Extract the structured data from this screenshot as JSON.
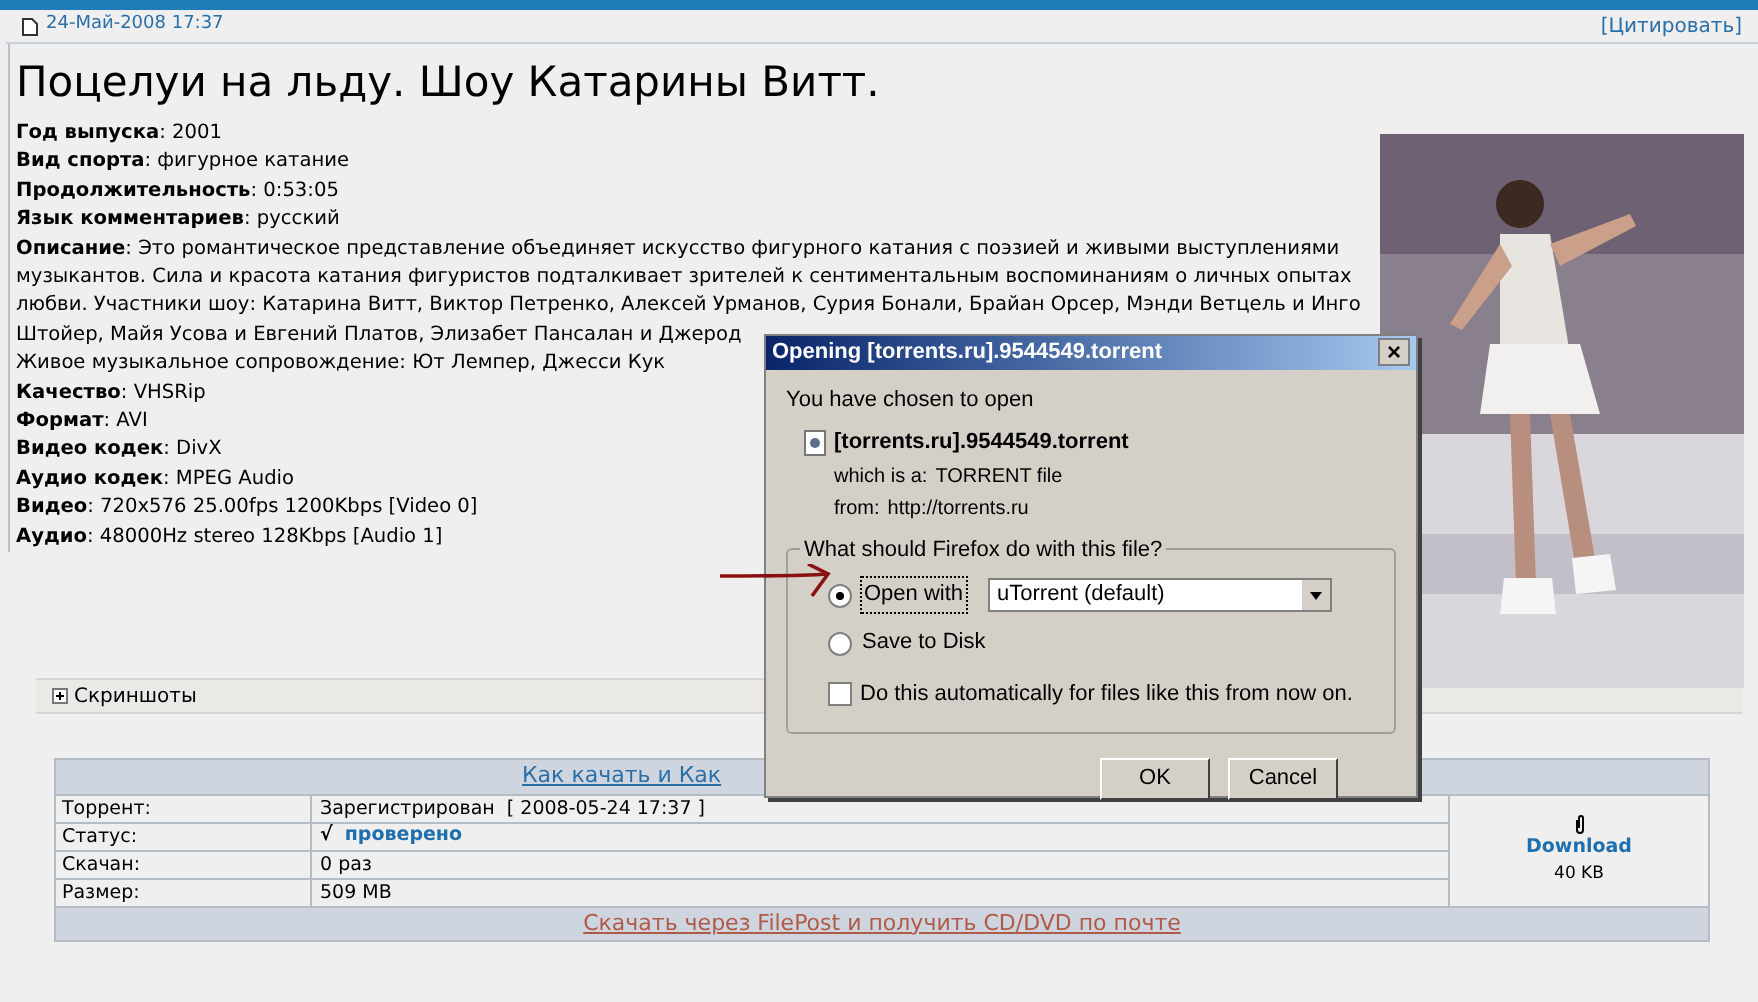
{
  "post": {
    "date": "24-Май-2008 17:37",
    "quote_link": "[Цитировать]"
  },
  "title": "Поцелуи на льду. Шоу Катарины Витт.",
  "fields": [
    {
      "kind": "labeled",
      "label": "Год выпуска",
      "value": ": 2001"
    },
    {
      "kind": "labeled",
      "label": "Вид спорта",
      "value": ": фигурное катание"
    },
    {
      "kind": "labeled",
      "label": "Продолжительность",
      "value": ": 0:53:05"
    },
    {
      "kind": "labeled",
      "label": "Язык комментариев",
      "value": ": русский"
    },
    {
      "kind": "labeled",
      "label": "Описание",
      "value": ": Это романтическое представление объединяет искусство фигурного катания с поэзией и живыми выступлениями"
    },
    {
      "kind": "plain",
      "value": "музыкантов. Сила и красота катания фигуристов подталкивает зрителей к сентиментальным воспоминаниям о личных опытах"
    },
    {
      "kind": "plain",
      "value": "любви. Участники шоу: Катарина Витт, Виктор Петренко, Алексей Урманов, Сурия Бонали, Брайан Орсер, Мэнди Ветцель и Инго"
    },
    {
      "kind": "plain",
      "value": "Штойер, Майя Усова и Евгений Платов, Элизабет Пансалан и Джерод"
    },
    {
      "kind": "plain",
      "value": "Живое музыкальное сопровождение: Ют Лемпер, Джесси Кук"
    },
    {
      "kind": "labeled",
      "label": "Качество",
      "value": ": VHSRip"
    },
    {
      "kind": "labeled",
      "label": "Формат",
      "value": ": AVI"
    },
    {
      "kind": "labeled",
      "label": "Видео кодек",
      "value": ": DivX"
    },
    {
      "kind": "labeled",
      "label": "Аудио кодек",
      "value": ": MPEG Audio"
    },
    {
      "kind": "labeled",
      "label": "Видео",
      "value": ": 720x576 25.00fps 1200Kbps [Video 0]"
    },
    {
      "kind": "labeled",
      "label": "Аудио",
      "value": ": 48000Hz stereo 128Kbps [Audio 1]"
    }
  ],
  "spoiler": {
    "label": "Скриншоты",
    "expanded": false
  },
  "torrent_table": {
    "header_link": "Как качать и Как",
    "rows": [
      {
        "label": "Торрент:",
        "value": "Зарегистрирован  [ 2008-05-24 17:37 ]",
        "kind": "text"
      },
      {
        "label": "Статус:",
        "mark": "√",
        "value": "проверено",
        "kind": "status"
      },
      {
        "label": "Скачан:",
        "value": "0 раз",
        "kind": "text"
      },
      {
        "label": "Размер:",
        "value": "509 MB",
        "kind": "text"
      }
    ],
    "download": {
      "label": "Download",
      "size": "40 KB"
    },
    "footer_link": "Скачать через FilePost и получить CD/DVD по почте"
  },
  "dialog": {
    "title": "Opening [torrents.ru].9544549.torrent",
    "close": "×",
    "intro": "You have chosen to open",
    "file_name": "[torrents.ru].9544549.torrent",
    "details": [
      {
        "label": "which is a:",
        "value": "TORRENT file"
      },
      {
        "label": "from:",
        "value": "http://torrents.ru"
      }
    ],
    "group_label": "What should Firefox do with this file?",
    "options": [
      {
        "label": "Open with",
        "selected": true,
        "kind": "app"
      },
      {
        "label": "Save to Disk",
        "selected": false,
        "kind": "plain"
      }
    ],
    "app": "uTorrent (default)",
    "auto": {
      "label": "Do this automatically for files like this from now on.",
      "checked": false
    },
    "buttons": [
      "OK",
      "Cancel"
    ]
  }
}
